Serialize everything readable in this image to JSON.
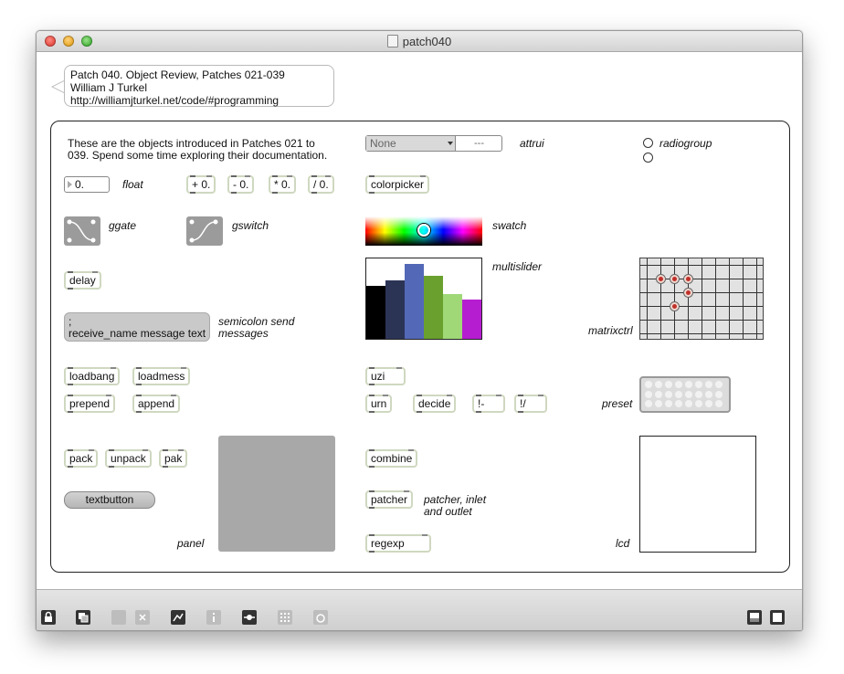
{
  "window": {
    "title": "patch040"
  },
  "header_comment": {
    "line1": "Patch 040. Object Review, Patches 021-039",
    "line2": "William J Turkel",
    "line3": "http://williamjturkel.net/code/#programming"
  },
  "intro": {
    "line1": "These are the objects introduced in Patches 021 to",
    "line2": "039. Spend some time exploring their documentation."
  },
  "objects": {
    "float_value": "0.",
    "float_label": "float",
    "plus": "+ 0.",
    "minus": "- 0.",
    "times": "* 0.",
    "divide": "/ 0.",
    "ggate_label": "ggate",
    "gswitch_label": "gswitch",
    "delay": "delay",
    "message_line1": ";",
    "message_line2": "receive_name message text",
    "semicolon_label_1": "semicolon send",
    "semicolon_label_2": "messages",
    "loadbang": "loadbang",
    "loadmess": "loadmess",
    "prepend": "prepend",
    "append": "append",
    "pack": "pack",
    "unpack": "unpack",
    "pak": "pak",
    "textbutton": "textbutton",
    "panel_label": "panel",
    "attrui_menu": "None",
    "attrui_value": "---",
    "attrui_label": "attrui",
    "radiogroup_label": "radiogroup",
    "colorpicker": "colorpicker",
    "swatch_label": "swatch",
    "multislider_label": "multislider",
    "matrixctrl_label": "matrixctrl",
    "uzi": "uzi",
    "urn": "urn",
    "decide": "decide",
    "not_op": "!-",
    "not_div": "!/",
    "preset_label": "preset",
    "combine": "combine",
    "patcher": "patcher",
    "patcher_label_1": "patcher, inlet",
    "patcher_label_2": "and outlet",
    "regexp": "regexp",
    "lcd_label": "lcd"
  },
  "multislider_data": {
    "values": [
      0.66,
      0.73,
      0.93,
      0.78,
      0.56,
      0.49
    ],
    "colors": [
      "#000000",
      "#2c3456",
      "#5468b8",
      "#6aa12e",
      "#a0d878",
      "#b51ed0"
    ]
  },
  "toolbar": {
    "icons": [
      "lock-icon",
      "new-object-icon",
      "presentation-icon",
      "close-patcher-icon",
      "debug-icon",
      "info-icon",
      "connect-icon",
      "grid-icon",
      "snap-icon",
      "patcher-view-icon",
      "presentation-view-icon"
    ]
  }
}
